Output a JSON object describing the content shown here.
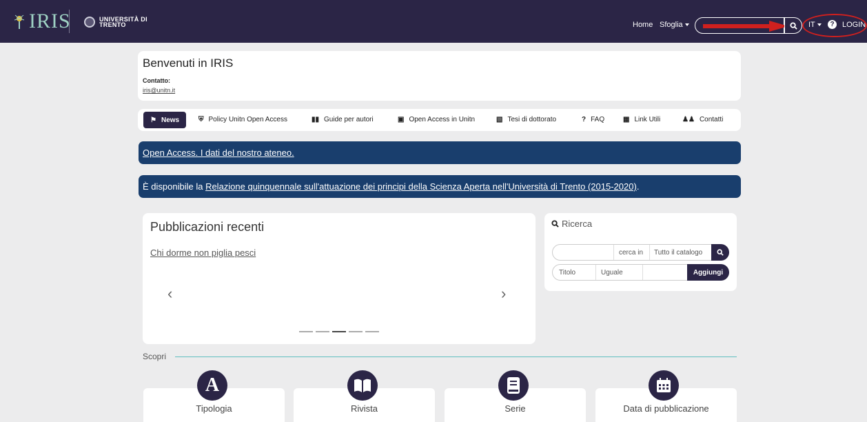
{
  "header": {
    "logo_text": "IRIS",
    "university": "UNIVERSITÀ DI TRENTO",
    "nav_home": "Home",
    "nav_sfoglia": "Sfoglia",
    "search_placeholder": "",
    "lang": "IT",
    "login": "LOGIN",
    "annotation_color": "#d0201e"
  },
  "welcome": {
    "title": "Benvenuti in IRIS",
    "contact_label": "Contatto:",
    "email": "iris@unitn.it"
  },
  "tabs": [
    {
      "label": "News",
      "icon": "megaphone-icon"
    },
    {
      "label": "Policy Unitn Open Access",
      "icon": "shield-icon"
    },
    {
      "label": "Guide per autori",
      "icon": "book-icon"
    },
    {
      "label": "Open Access in Unitn",
      "icon": "unlock-icon"
    },
    {
      "label": "Tesi di dottorato",
      "icon": "bookmark-book-icon"
    },
    {
      "label": "FAQ",
      "icon": "question-icon"
    },
    {
      "label": "Link Utili",
      "icon": "table-icon"
    },
    {
      "label": "Contatti",
      "icon": "users-icon"
    }
  ],
  "banners": {
    "b1_link": "Open Access. I dati del nostro ateneo.",
    "b2_prefix": "È disponibile la ",
    "b2_link": "Relazione quinquennale sull'attuazione dei principi della Scienza Aperta nell'Università di Trento (2015-2020)",
    "b2_suffix": "."
  },
  "recent": {
    "title": "Pubblicazioni recenti",
    "item": "Chi dorme non piglia pesci",
    "prev": "‹",
    "next": "›",
    "slides_total": 5,
    "slide_active": 3
  },
  "search": {
    "title": "Ricerca",
    "search_in_label": "cerca in",
    "catalog_value": "Tutto il catalogo",
    "field_value": "Titolo",
    "operator_value": "Uguale",
    "add_label": "Aggiungi"
  },
  "discover": {
    "title": "Scopri",
    "items": [
      {
        "label": "Tipologia",
        "icon": "letter-a-icon"
      },
      {
        "label": "Rivista",
        "icon": "open-book-icon"
      },
      {
        "label": "Serie",
        "icon": "book-icon"
      },
      {
        "label": "Data di pubblicazione",
        "icon": "calendar-icon"
      }
    ]
  },
  "colors": {
    "navbar": "#2b2546",
    "banner": "#193e6d",
    "accent_line": "#5fbfbf"
  }
}
